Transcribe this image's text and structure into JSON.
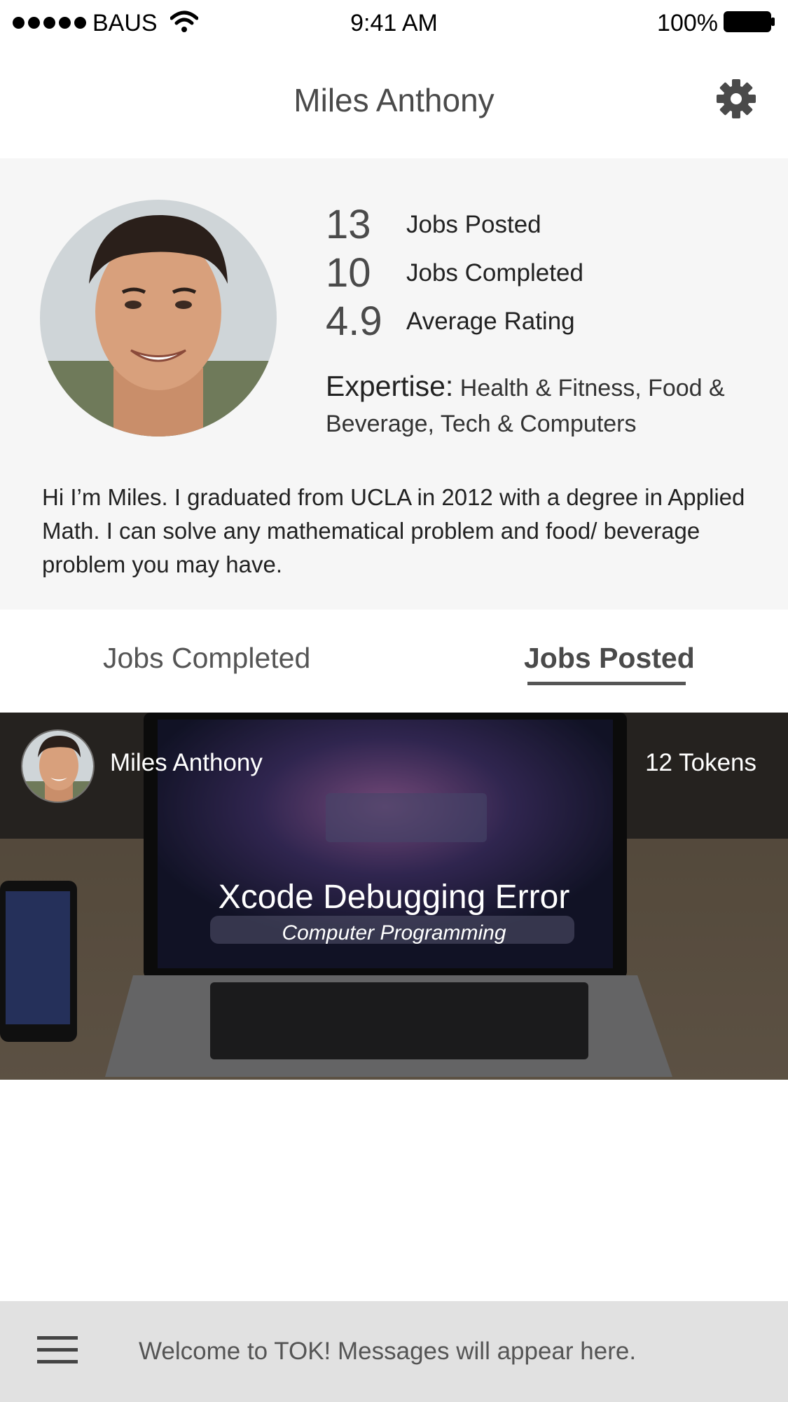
{
  "status_bar": {
    "carrier": "BAUS",
    "time": "9:41 AM",
    "battery": "100%"
  },
  "nav": {
    "title": "Miles Anthony",
    "settings_icon": "gear-icon"
  },
  "profile": {
    "stats": [
      {
        "value": "13",
        "label": "Jobs Posted"
      },
      {
        "value": "10",
        "label": "Jobs Completed"
      },
      {
        "value": "4.9",
        "label": "Average Rating"
      }
    ],
    "expertise_label": "Expertise:",
    "expertise_value": "Health & Fitness, Food & Beverage, Tech & Computers",
    "bio": "Hi I’m Miles. I graduated from UCLA in 2012 with a degree in Applied Math. I can solve any mathematical problem and food/ beverage problem you may have."
  },
  "tabs": {
    "completed": "Jobs Completed",
    "posted": "Jobs Posted",
    "active": "posted"
  },
  "job": {
    "author": "Miles Anthony",
    "tokens": "12 Tokens",
    "title": "Xcode Debugging Error",
    "category": "Computer Programming"
  },
  "message_bar": {
    "text": "Welcome to TOK! Messages will appear here.",
    "menu_icon": "hamburger-menu-icon"
  }
}
